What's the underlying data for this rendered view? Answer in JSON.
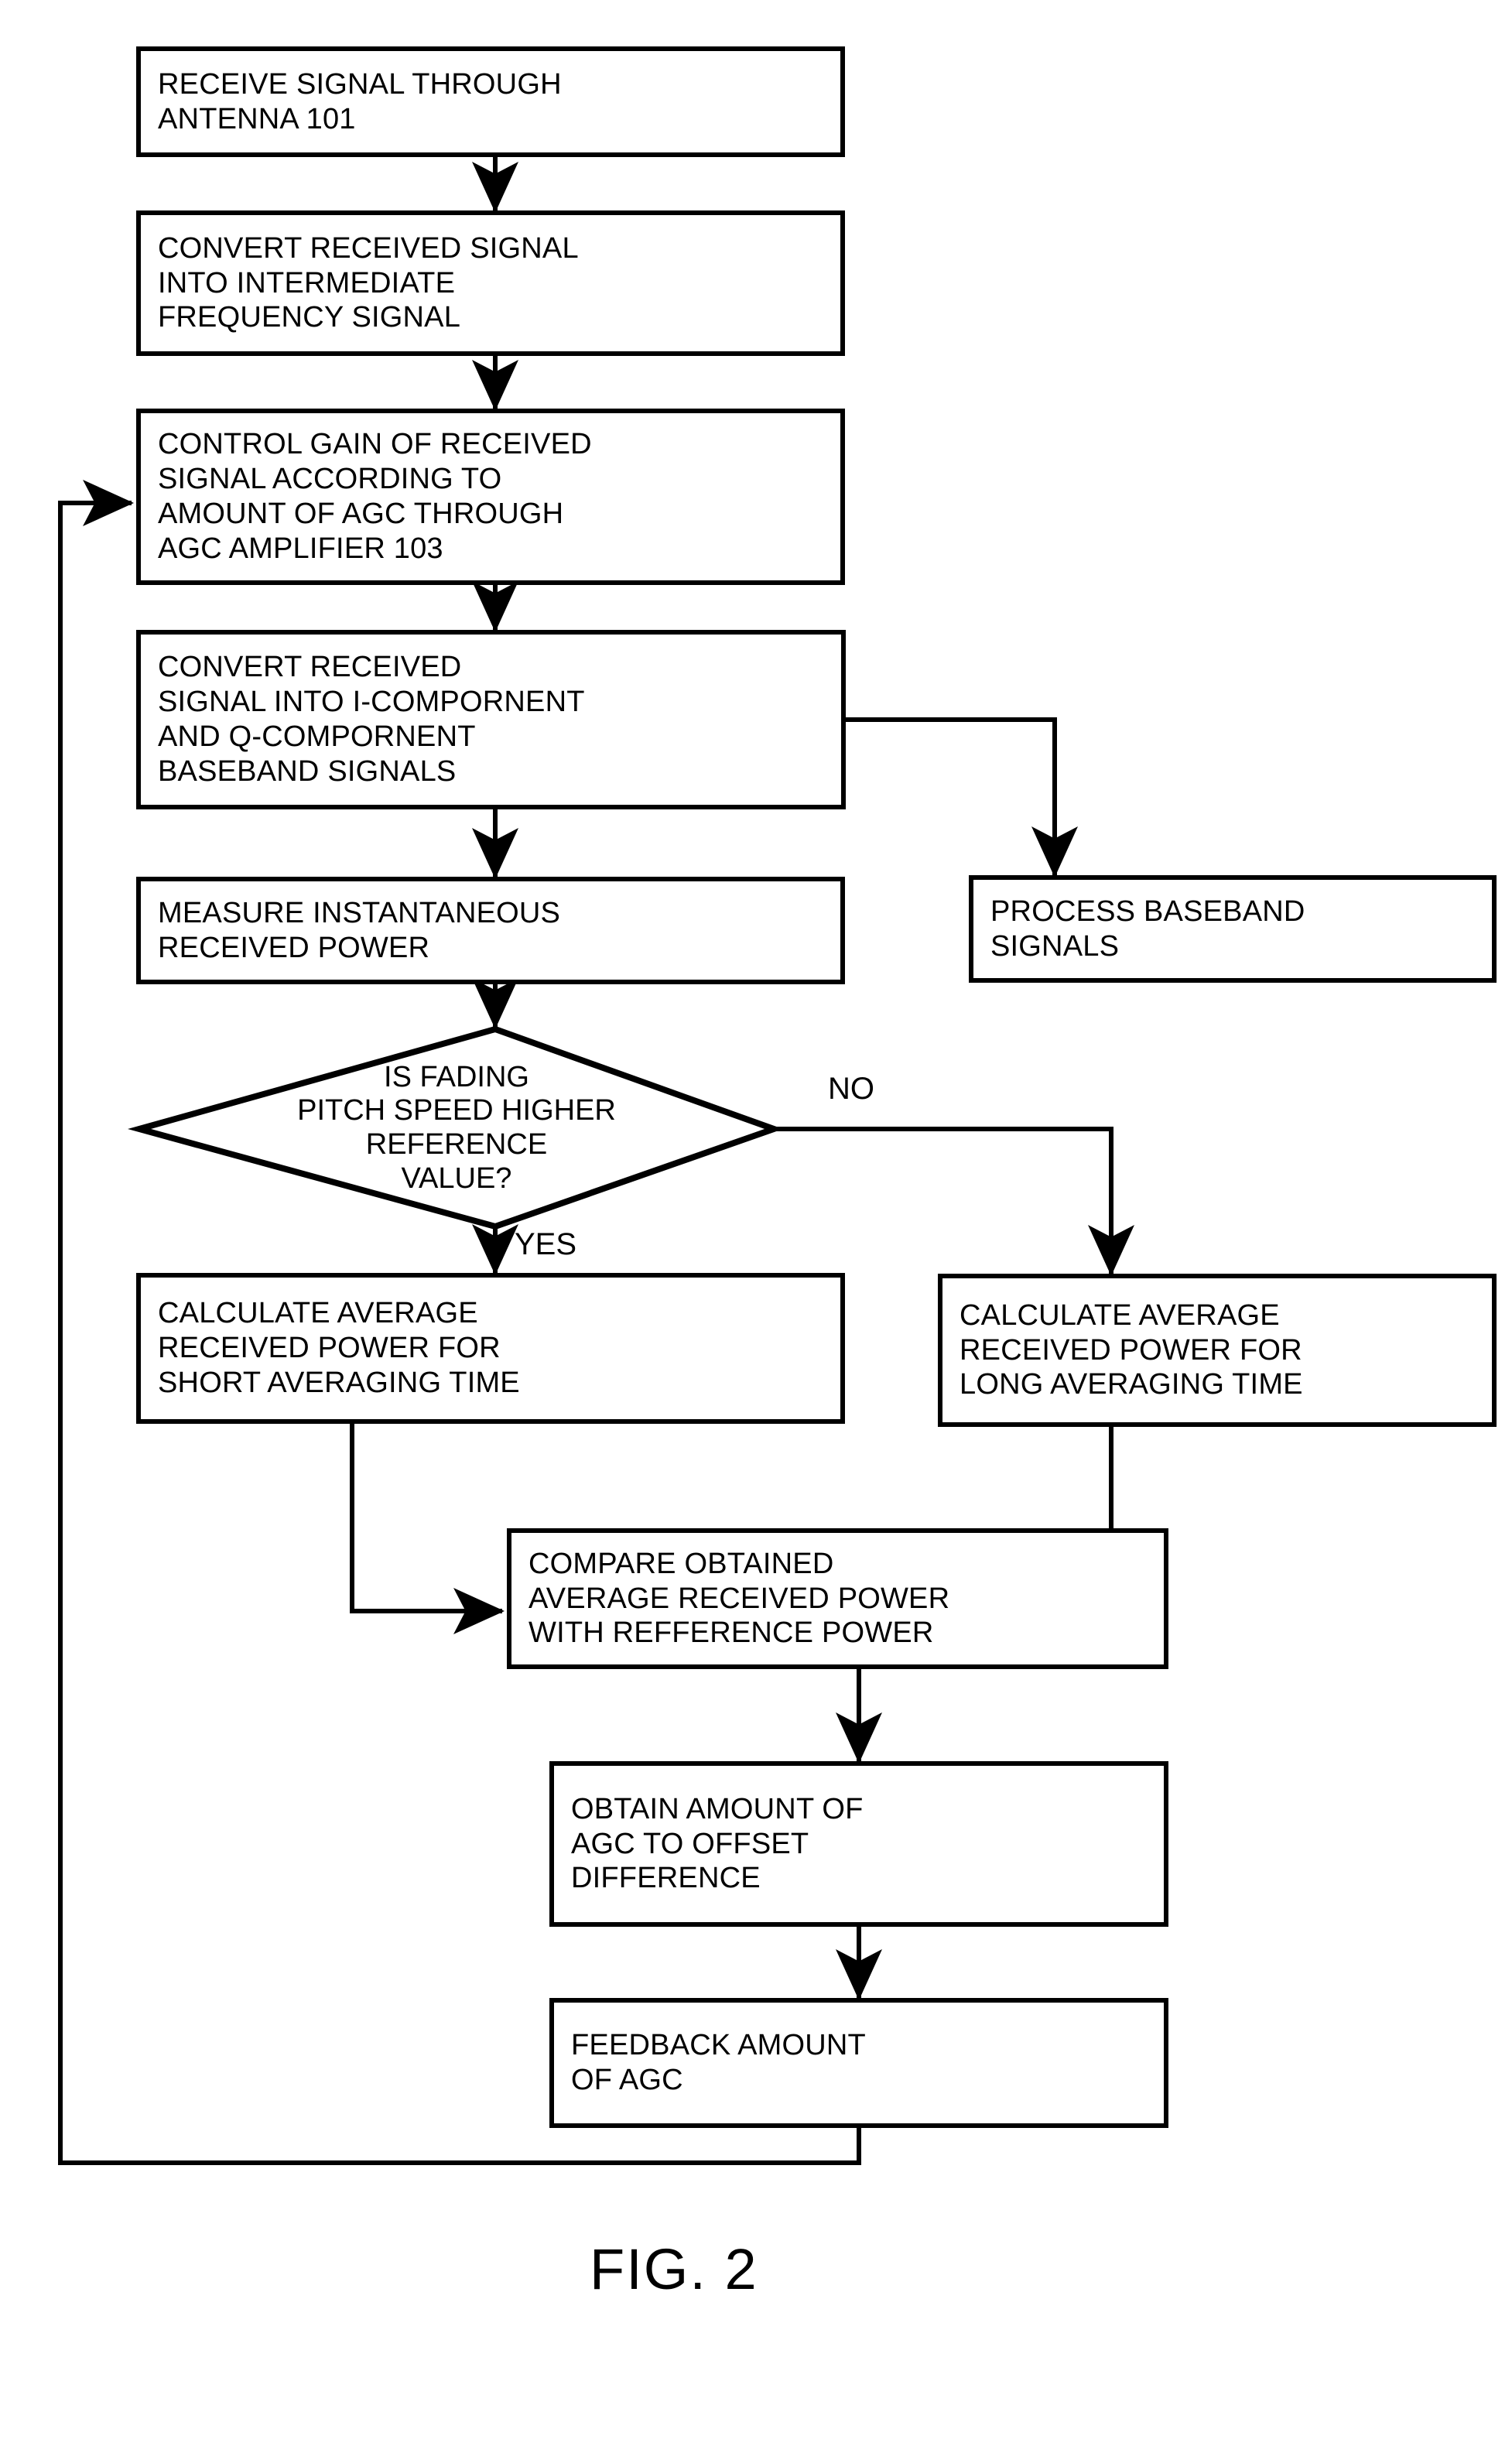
{
  "figure": {
    "caption": "FIG. 2",
    "type": "flowchart"
  },
  "colors": {
    "stroke": "#000000",
    "fill": "#ffffff",
    "text": "#000000"
  },
  "nodes": {
    "receive_signal": {
      "shape": "process",
      "lines": [
        "RECEIVE SIGNAL THROUGH",
        "ANTENNA 101"
      ]
    },
    "convert_if": {
      "shape": "process",
      "lines": [
        "CONVERT RECEIVED SIGNAL",
        "INTO INTERMEDIATE",
        "FREQUENCY SIGNAL"
      ]
    },
    "control_gain": {
      "shape": "process",
      "lines": [
        "CONTROL GAIN OF RECEIVED",
        "SIGNAL ACCORDING TO",
        "AMOUNT OF AGC THROUGH",
        "AGC AMPLIFIER 103"
      ]
    },
    "convert_iq": {
      "shape": "process",
      "lines": [
        "CONVERT RECEIVED",
        "SIGNAL INTO I-COMPORNENT",
        "AND Q-COMPORNENT",
        "BASEBAND SIGNALS"
      ]
    },
    "measure_power": {
      "shape": "process",
      "lines": [
        "MEASURE INSTANTANEOUS",
        "RECEIVED POWER"
      ]
    },
    "process_baseband": {
      "shape": "process",
      "lines": [
        "PROCESS BASEBAND",
        "SIGNALS"
      ]
    },
    "fading_decision": {
      "shape": "decision",
      "lines": [
        "IS FADING",
        "PITCH SPEED HIGHER",
        "REFERENCE",
        "VALUE?"
      ]
    },
    "calc_short": {
      "shape": "process",
      "lines": [
        "CALCULATE AVERAGE",
        "RECEIVED POWER FOR",
        "SHORT AVERAGING TIME"
      ]
    },
    "calc_long": {
      "shape": "process",
      "lines": [
        "CALCULATE AVERAGE",
        "RECEIVED POWER FOR",
        "LONG AVERAGING TIME"
      ]
    },
    "compare_power": {
      "shape": "process",
      "lines": [
        "COMPARE OBTAINED",
        "AVERAGE RECEIVED POWER",
        "WITH REFFERENCE POWER"
      ]
    },
    "obtain_agc": {
      "shape": "process",
      "lines": [
        "OBTAIN AMOUNT OF",
        "AGC TO OFFSET",
        "DIFFERENCE"
      ]
    },
    "feedback_agc": {
      "shape": "process",
      "lines": [
        "FEEDBACK AMOUNT",
        "OF AGC"
      ]
    }
  },
  "edge_labels": {
    "no": "NO",
    "yes": "YES"
  }
}
